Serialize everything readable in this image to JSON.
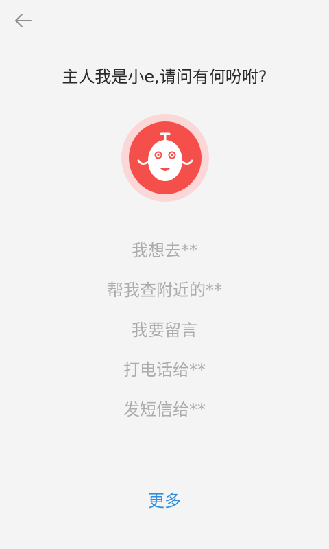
{
  "header": {
    "back_icon": "arrow-left-icon"
  },
  "assistant": {
    "greeting": "主人我是小e,请问有何吩咐?",
    "avatar_icon": "robot-face-icon",
    "colors": {
      "avatar_red": "#f44f4a",
      "avatar_ring": "#fbd7d8"
    }
  },
  "suggestions": [
    {
      "label": "我想去**"
    },
    {
      "label": "帮我查附近的**"
    },
    {
      "label": "我要留言"
    },
    {
      "label": "打电话给**"
    },
    {
      "label": "发短信给**"
    }
  ],
  "footer": {
    "more_label": "更多",
    "accent": "#2f8fe0"
  }
}
